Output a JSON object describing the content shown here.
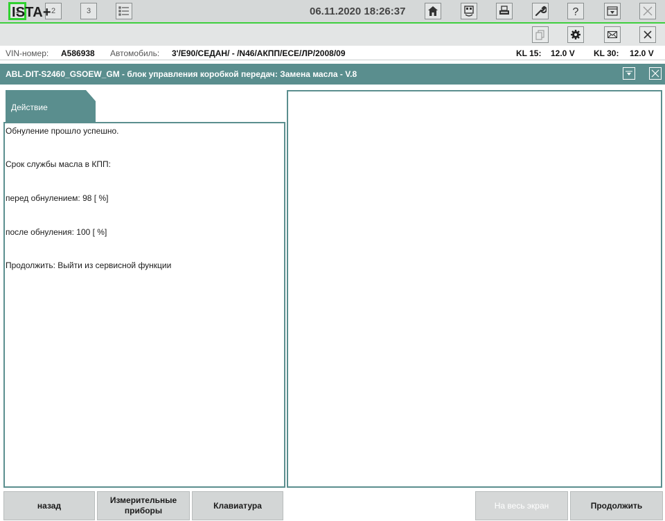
{
  "toolbar": {
    "tabs": [
      {
        "label": "1"
      },
      {
        "label": "2"
      },
      {
        "label": "3"
      }
    ],
    "datetime": "06.11.2020 18:26:37",
    "accent": "#3ecf3e"
  },
  "app": {
    "title": "ISTA+"
  },
  "vehicle": {
    "vin_label": "VIN-номер:",
    "vin_value": "A586938",
    "car_label": "Автомобиль:",
    "car_value": "3'/E90/СЕДАН/ - /N46/АКПП/ECE/ЛР/2008/09",
    "kl15_label": "KL 15:",
    "kl15_value": "12.0 V",
    "kl30_label": "KL 30:",
    "kl30_value": "12.0 V"
  },
  "function": {
    "title": "ABL-DIT-S2460_GSOEW_GM - блок управления коробкой передач: Замена масла - V.8",
    "color": "#5a8e8e"
  },
  "action_panel": {
    "tab_label": "Действие",
    "messages": [
      "Обнуление прошло успешно.",
      "Срок службы масла в КПП:",
      "перед обнулением: 98 [ %]",
      "после обнуления: 100 [ %]",
      "Продолжить: Выйти из сервисной функции"
    ]
  },
  "buttons": {
    "back": "назад",
    "meters_line1": "Измерительные",
    "meters_line2": "приборы",
    "keyboard": "Клавиатура",
    "fullscreen": "На весь экран",
    "continue": "Продолжить"
  },
  "icons": {
    "list": "list-icon",
    "home": "home-icon",
    "vehicle_id": "vehicle-id-icon",
    "print": "print-icon",
    "wrench": "wrench-icon",
    "help": "help-icon",
    "minimize": "minimize-icon",
    "close": "close-icon",
    "document": "document-icon",
    "settings": "gear-icon",
    "mail": "envelope-icon"
  }
}
